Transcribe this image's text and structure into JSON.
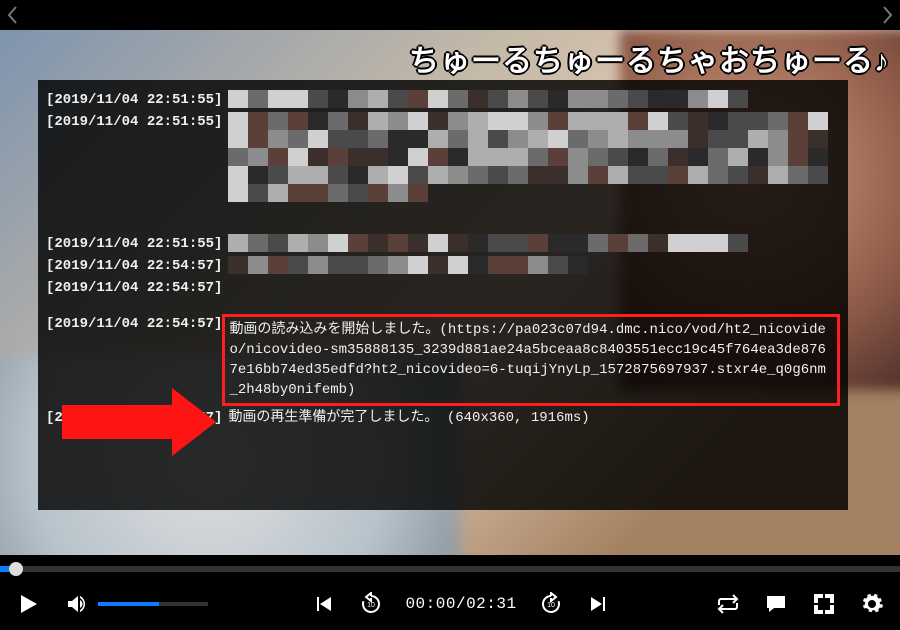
{
  "comment_overlay": "ちゅーるちゅーるちゃおちゅーる♪",
  "log": {
    "line0": {
      "ts": "[2019/11/04 22:51:55]"
    },
    "line1": {
      "ts": "[2019/11/04 22:51:55]"
    },
    "line2": {
      "ts": "[2019/11/04 22:51:55]"
    },
    "line3": {
      "ts": "[2019/11/04 22:51:55]"
    },
    "line4": {
      "ts": "[2019/11/04 22:54:57]"
    },
    "line5": {
      "ts": "[2019/11/04 22:54:57]"
    },
    "highlight": {
      "ts": "[2019/11/04 22:54:57]",
      "msg": "動画の読み込みを開始しました。(https://pa023c07d94.dmc.nico/vod/ht2_nicovideo/nicovideo-sm35888135_3239d881ae24a5bceaa8c8403551ecc19c45f764ea3de8767e16bb74ed35edfd?ht2_nicovideo=6-tuqijYnyLp_1572875697937.stxr4e_q0g6nm_2h48by0nifemb)"
    },
    "line7": {
      "ts": "[2019/11/04 22:54:57]",
      "msg": "動画の再生準備が完了しました。 (640x360, 1916ms)"
    }
  },
  "playback": {
    "current": "00:00",
    "total": "02:31",
    "sep": "/"
  }
}
